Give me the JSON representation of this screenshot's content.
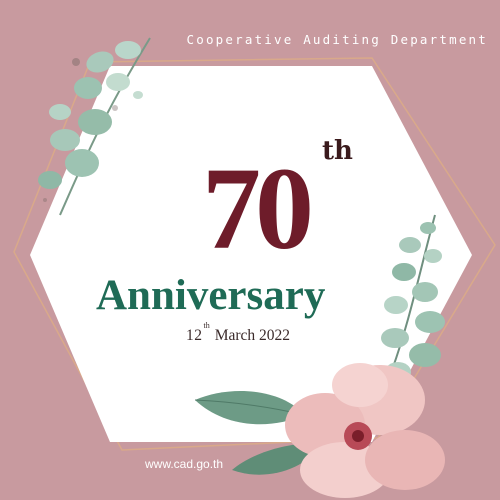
{
  "header": {
    "department": "Cooperative Auditing Department"
  },
  "badge": {
    "number": "70",
    "ordinal_suffix": "th",
    "title": "Anniversary"
  },
  "date": {
    "day": "12",
    "day_suffix": "th",
    "month_year": "March 2022"
  },
  "footer": {
    "url": "www.cad.go.th"
  },
  "colors": {
    "background": "#c89a9f",
    "hexagon_fill": "#ffffff",
    "frame_line": "#d9a98a",
    "number": "#6e1c2a",
    "title": "#1f6b56",
    "leaf": "#8fb8a6",
    "flower": "#f0c6c4"
  },
  "decorations": [
    "eucalyptus-branch-icon",
    "rose-flower-icon",
    "green-leaf-icon"
  ]
}
